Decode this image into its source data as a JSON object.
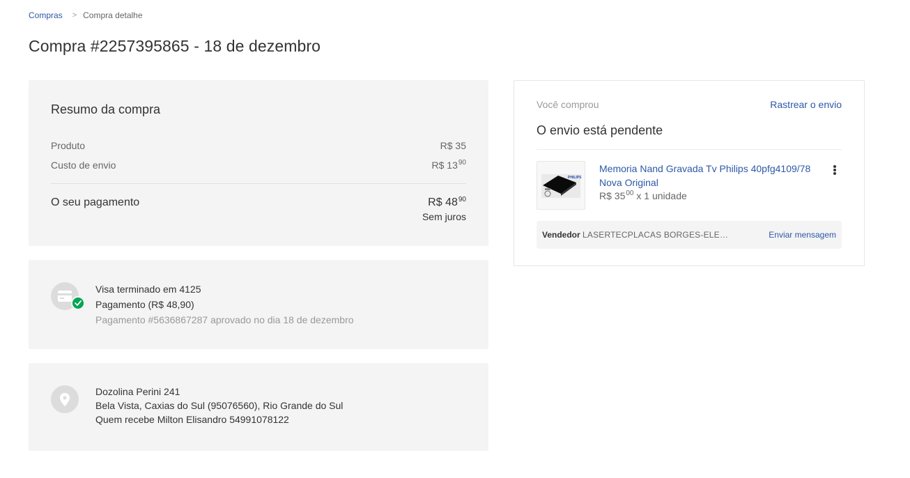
{
  "breadcrumb": {
    "parent": "Compras",
    "separator": ">",
    "current": "Compra detalhe"
  },
  "page_title": "Compra #2257395865 - 18 de dezembro",
  "summary": {
    "title": "Resumo da compra",
    "product_label": "Produto",
    "product_amount": "R$ 35",
    "shipping_label": "Custo de envio",
    "shipping_amount": "R$ 13",
    "shipping_cents": "90",
    "payment_label": "O seu pagamento",
    "payment_amount": "R$ 48",
    "payment_cents": "90",
    "interest_note": "Sem juros"
  },
  "payment": {
    "icon": "credit-card-icon",
    "status_icon": "check-icon",
    "card_line": "Visa terminado em 4125",
    "amount_line": "Pagamento (R$ 48,90)",
    "approval_line": "Pagamento #5636867287 aprovado no dia 18 de dezembro"
  },
  "address": {
    "icon": "location-pin-icon",
    "street": "Dozolina Perini 241",
    "city_line": "Bela Vista, Caxias do Sul (95076560), Rio Grande do Sul",
    "receiver": "Quem recebe Milton Elisandro 54991078122"
  },
  "shipment": {
    "bought_label": "Você comprou",
    "track_link": "Rastrear o envio",
    "status": "O envio está pendente",
    "product": {
      "title": "Memoria Nand Gravada Tv Philips 40pfg4109/78 Nova Original",
      "price": "R$ 35",
      "price_cents": "00",
      "quantity": " x 1 unidade",
      "thumb_brand": "PHILIPS"
    },
    "seller_label": "Vendedor",
    "seller_name": "LASERTECPLACAS BORGES-ELE…",
    "message_link": "Enviar mensagem"
  },
  "colors": {
    "link": "#2d58a7",
    "card_bg": "#f4f4f4",
    "success": "#00a650"
  }
}
